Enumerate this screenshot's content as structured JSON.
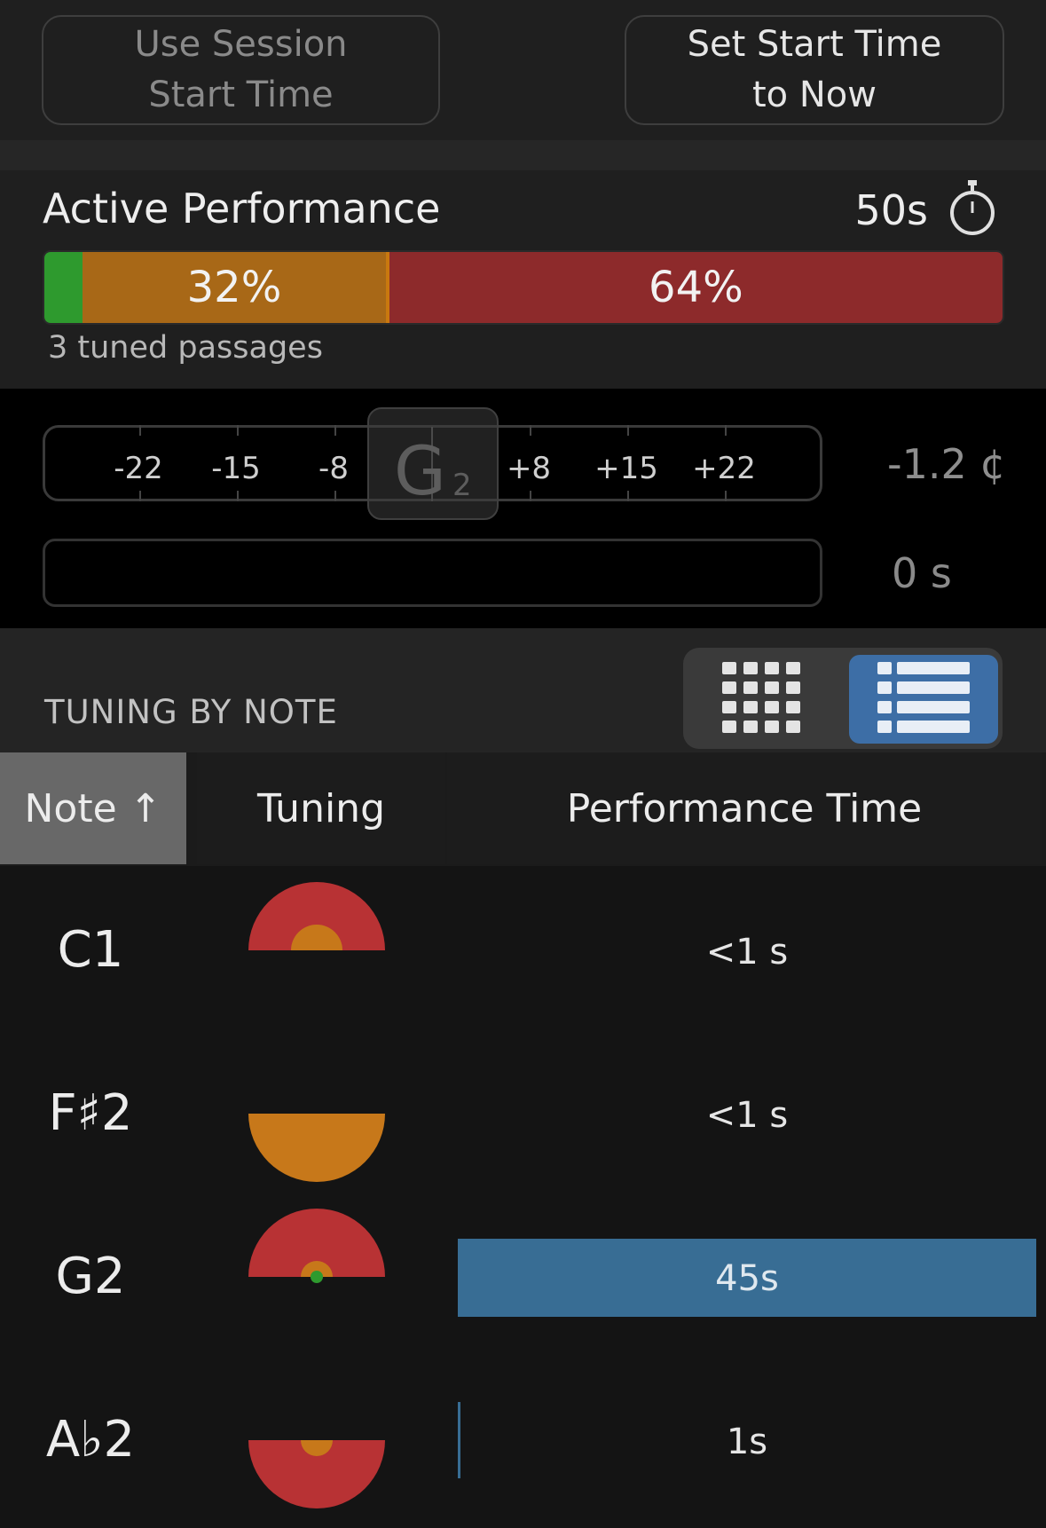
{
  "top_buttons": {
    "use_session_start": "Use Session\nStart Time",
    "set_start_now": "Set Start Time\nto Now"
  },
  "active_performance": {
    "title": "Active Performance",
    "time": "50s",
    "breakdown": {
      "green_fraction": 0.04,
      "orange_fraction": 0.32,
      "red_fraction": 0.64,
      "orange_label": "32%",
      "red_label": "64%"
    },
    "passages": "3 tuned passages"
  },
  "tuner": {
    "scale_labels": [
      "-22",
      "-15",
      "-8",
      "+8",
      "+15",
      "+22"
    ],
    "note_letter": "G",
    "note_octave": "2",
    "cents": "-1.2 ¢",
    "hold_time": "0 s"
  },
  "tuning_by_note": {
    "title": "TUNING BY NOTE",
    "view_mode": "list"
  },
  "table": {
    "headers": {
      "note": "Note ↑",
      "tuning": "Tuning",
      "performance_time": "Performance Time"
    },
    "rows": [
      {
        "note": "C1",
        "time": "<1 s",
        "dial": "upper",
        "time_fraction": 0
      },
      {
        "note": "F♯2",
        "time": "<1 s",
        "dial": "lower-orange",
        "time_fraction": 0
      },
      {
        "note": "G2",
        "time": "45s",
        "dial": "upper-green",
        "time_fraction": 1.0
      },
      {
        "note": "A♭2",
        "time": "1s",
        "dial": "lower",
        "time_fraction": 0.005
      }
    ]
  },
  "colors": {
    "green": "#2e9a2e",
    "orange": "#c7781a",
    "red": "#b83234",
    "blue": "#386d94",
    "accent": "#3d6ea6"
  }
}
